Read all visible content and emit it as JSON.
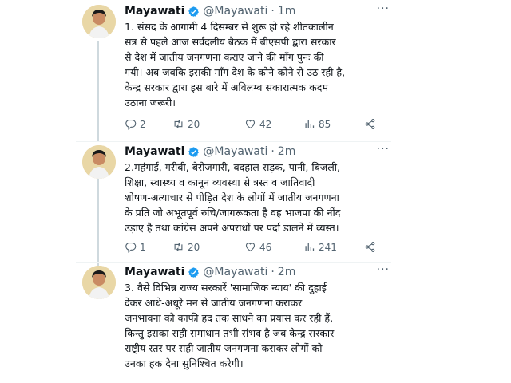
{
  "tweets": [
    {
      "name": "Mayawati",
      "handle": "@Mayawati",
      "dot": "·",
      "time": "1m",
      "text": "1. संसद के आगामी 4 दिसम्बर से शुरू हो रहे शीतकालीन\nसत्र से पहले आज सर्वदलीय बैठक में बीएसपी द्वारा सरकार\nसे देश में जातीय जनगणना कराए जाने की माँग पुनः की\nगयी। अब जबकि इसकी माँग देश के कोने-कोने से उठ रही है,\nकेन्द्र सरकार द्वारा इस बारे में अविलम्ब सकारात्मक कदम\nउठाना जरूरी।",
      "replies": "2",
      "retweets": "20",
      "likes": "42",
      "views": "85"
    },
    {
      "name": "Mayawati",
      "handle": "@Mayawati",
      "dot": "·",
      "time": "2m",
      "text": "2.महंगाई, गरीबी, बेरोजगारी, बदहाल सड़क, पानी, बिजली,\nशिक्षा, स्वास्थ्य व कानून व्यवस्था से त्रस्त व जातिवादी\nशोषण-अत्याचार से पीड़ित देश के लोगों में जातीय जनगणना\nके प्रति जो अभूतपूर्व रुचि/जागरूकता है वह भाजपा की नींद\nउड़ाए है तथा कांग्रेस अपने अपराधों पर पर्दा डालने में व्यस्त।",
      "replies": "1",
      "retweets": "20",
      "likes": "46",
      "views": "241"
    },
    {
      "name": "Mayawati",
      "handle": "@Mayawati",
      "dot": "·",
      "time": "2m",
      "text": "3. वैसे विभिन्न राज्य सरकारें 'सामाजिक न्याय' की दुहाई\nदेकर आधे-अधूरे मन से जातीय जनगणना कराकर\nजनभावना को काफी हद तक साधने का प्रयास कर रही हैं,\nकिन्तु इसका सही समाधान तभी संभव है जब केन्द्र सरकार\nराष्ट्रीय स्तर पर सही जातीय जनगणना कराकर लोगों को\nउनका हक देना सुनिश्चित करेगी।"
    }
  ],
  "more_label": "···",
  "icons": {
    "verified": "verified-badge-icon",
    "reply": "reply-icon",
    "retweet": "retweet-icon",
    "like": "heart-icon",
    "views": "views-icon",
    "share": "share-icon"
  },
  "colors": {
    "verified": "#1d9bf0",
    "muted": "#536471",
    "line": "#cfd9de"
  }
}
